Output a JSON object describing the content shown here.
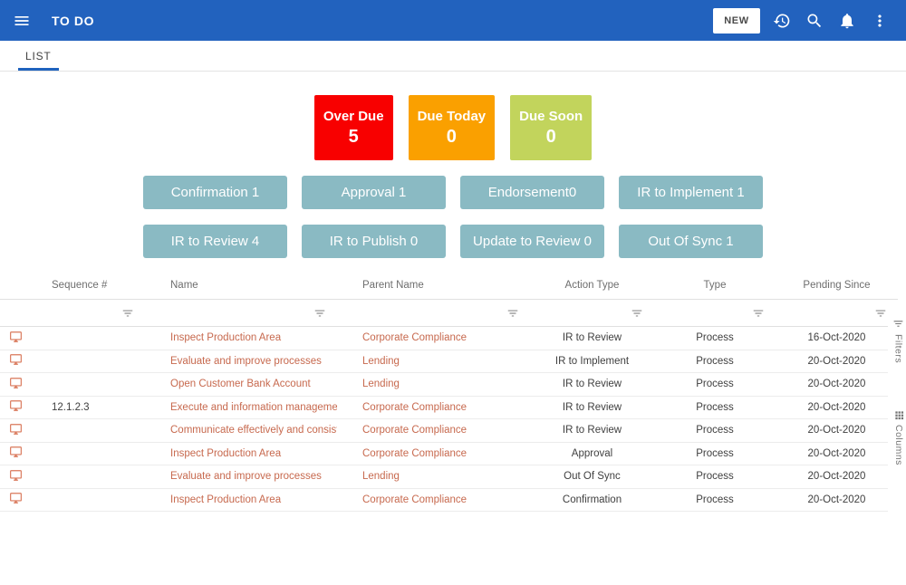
{
  "header": {
    "title": "TO DO",
    "new_button_label": "NEW",
    "accent_color": "#2262be"
  },
  "tab_bar": {
    "active_tab_label": "LIST"
  },
  "summary_cards": [
    {
      "label": "Over Due",
      "count": "5",
      "color": "#f80000"
    },
    {
      "label": "Due Today",
      "count": "0",
      "color": "#faa000"
    },
    {
      "label": "Due Soon",
      "count": "0",
      "color": "#c2d45c"
    }
  ],
  "category_buttons": {
    "color": "#8abac3",
    "rows": [
      [
        "Confirmation 1",
        "Approval 1",
        "Endorsement0",
        "IR to Implement 1"
      ],
      [
        "IR to Review 4",
        "IR to Publish 0",
        "Update to Review 0",
        "Out Of Sync 1"
      ]
    ]
  },
  "table": {
    "columns": [
      "Sequence #",
      "Name",
      "Parent Name",
      "Action Type",
      "Type",
      "Pending Since"
    ],
    "link_color": "#c7694e",
    "rows": [
      {
        "sequence": "",
        "name": "Inspect Production Area",
        "parent_name": "Corporate Compliance",
        "action_type": "IR to Review",
        "type": "Process",
        "pending_since": "16-Oct-2020"
      },
      {
        "sequence": "",
        "name": "Evaluate and improve processes",
        "parent_name": "Lending",
        "action_type": "IR to Implement",
        "type": "Process",
        "pending_since": "20-Oct-2020"
      },
      {
        "sequence": "",
        "name": "Open Customer Bank Account",
        "parent_name": "Lending",
        "action_type": "IR to Review",
        "type": "Process",
        "pending_since": "20-Oct-2020"
      },
      {
        "sequence": "12.1.2.3",
        "name": "Execute and information management plan",
        "parent_name": "Corporate Compliance",
        "action_type": "IR to Review",
        "type": "Process",
        "pending_since": "20-Oct-2020"
      },
      {
        "sequence": "",
        "name": "Communicate effectively and consistently",
        "parent_name": "Corporate Compliance",
        "action_type": "IR to Review",
        "type": "Process",
        "pending_since": "20-Oct-2020"
      },
      {
        "sequence": "",
        "name": "Inspect Production Area",
        "parent_name": "Corporate Compliance",
        "action_type": "Approval",
        "type": "Process",
        "pending_since": "20-Oct-2020"
      },
      {
        "sequence": "",
        "name": "Evaluate and improve processes",
        "parent_name": "Lending",
        "action_type": "Out Of Sync",
        "type": "Process",
        "pending_since": "20-Oct-2020"
      },
      {
        "sequence": "",
        "name": "Inspect Production Area",
        "parent_name": "Corporate Compliance",
        "action_type": "Confirmation",
        "type": "Process",
        "pending_since": "20-Oct-2020"
      }
    ]
  },
  "side_rail": {
    "filters_label": "Filters",
    "columns_label": "Columns"
  },
  "icons": {
    "header": [
      "menu-icon",
      "history-icon",
      "search-icon",
      "notifications-icon",
      "more-options-icon"
    ],
    "table": [
      "monitor-icon",
      "filter-icon"
    ],
    "rail": [
      "filter-list-icon",
      "grid-icon"
    ]
  }
}
